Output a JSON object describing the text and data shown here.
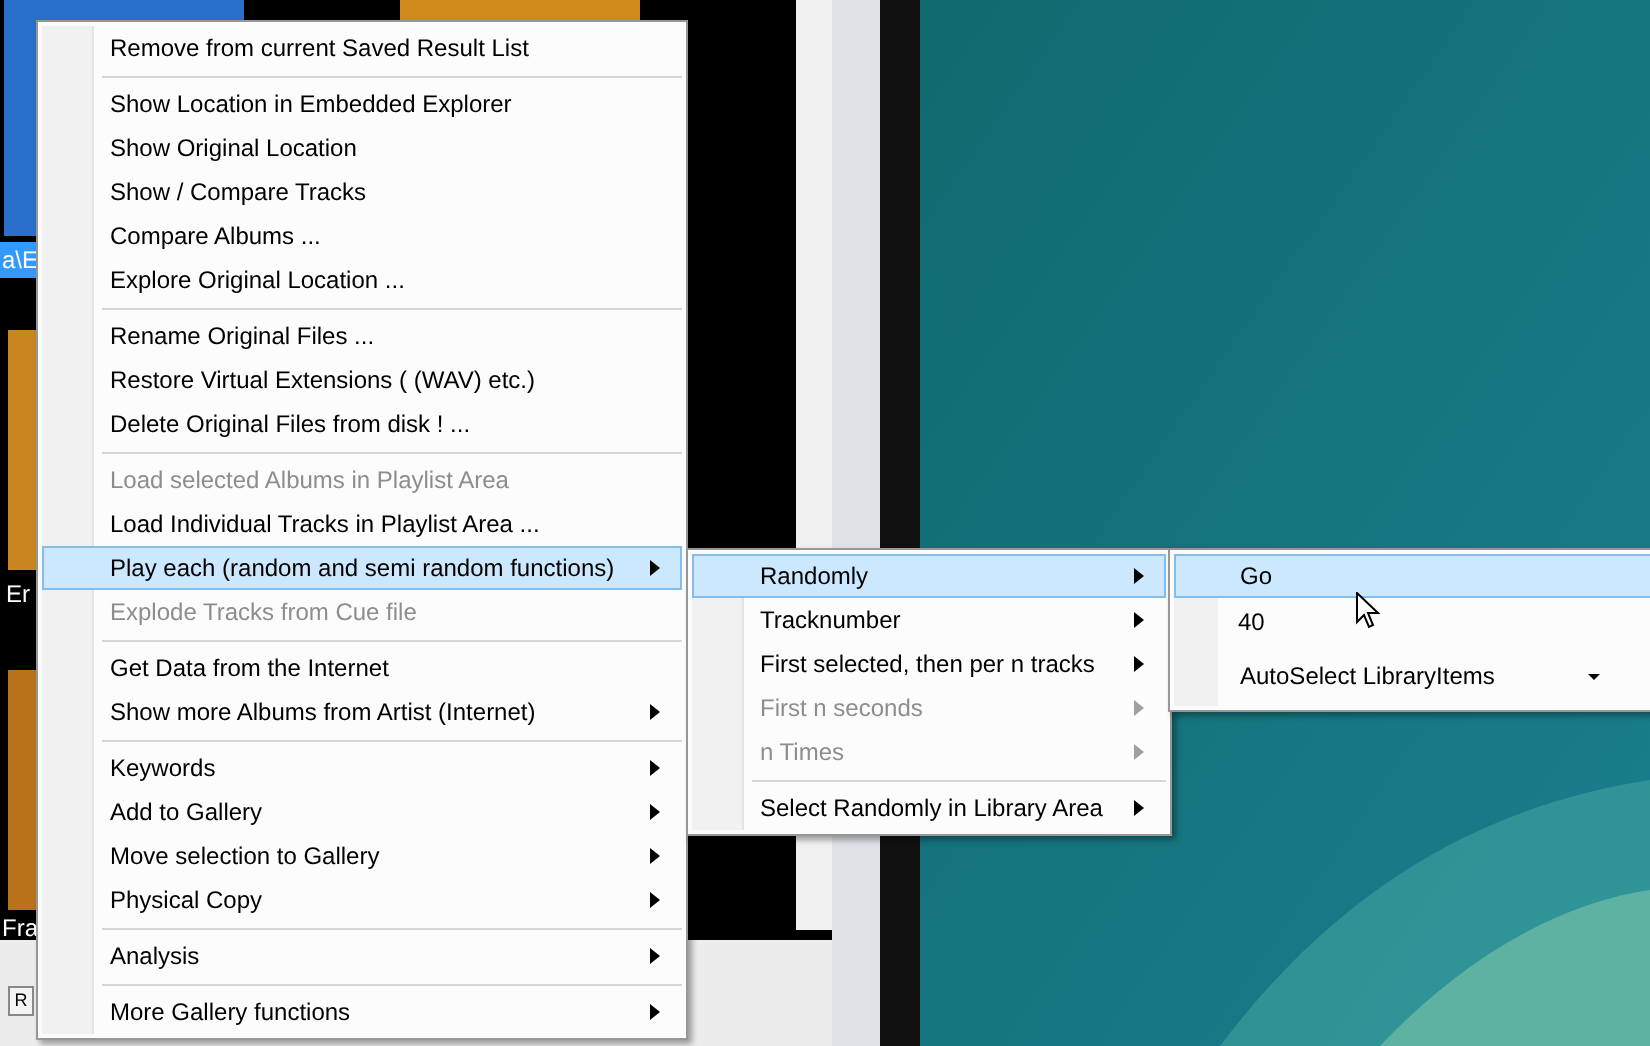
{
  "background_labels": [
    {
      "text": "a\\E",
      "selected": true
    },
    {
      "text": "Er",
      "selected": false
    },
    {
      "text": "Fra",
      "selected": false
    }
  ],
  "bottom_button": "R",
  "context_menu": {
    "items": [
      {
        "kind": "item",
        "label": "Remove from current Saved Result List",
        "disabled": false,
        "selected": false,
        "submenu": false
      },
      {
        "kind": "separator"
      },
      {
        "kind": "item",
        "label": "Show Location in Embedded Explorer",
        "disabled": false,
        "selected": false,
        "submenu": false
      },
      {
        "kind": "item",
        "label": "Show Original Location",
        "disabled": false,
        "selected": false,
        "submenu": false
      },
      {
        "kind": "item",
        "label": "Show / Compare Tracks",
        "disabled": false,
        "selected": false,
        "submenu": false
      },
      {
        "kind": "item",
        "label": "Compare Albums ...",
        "disabled": false,
        "selected": false,
        "submenu": false
      },
      {
        "kind": "item",
        "label": "Explore Original Location ...",
        "disabled": false,
        "selected": false,
        "submenu": false
      },
      {
        "kind": "separator"
      },
      {
        "kind": "item",
        "label": "Rename Original Files ...",
        "disabled": false,
        "selected": false,
        "submenu": false
      },
      {
        "kind": "item",
        "label": "Restore Virtual Extensions ( (WAV) etc.)",
        "disabled": false,
        "selected": false,
        "submenu": false
      },
      {
        "kind": "item",
        "label": "Delete Original Files from disk ! ...",
        "disabled": false,
        "selected": false,
        "submenu": false
      },
      {
        "kind": "separator"
      },
      {
        "kind": "item",
        "label": "Load selected Albums in Playlist Area",
        "disabled": true,
        "selected": false,
        "submenu": false
      },
      {
        "kind": "item",
        "label": "Load Individual Tracks in Playlist Area ...",
        "disabled": false,
        "selected": false,
        "submenu": false
      },
      {
        "kind": "item",
        "label": "Play each (random and semi random functions)",
        "disabled": false,
        "selected": true,
        "submenu": true
      },
      {
        "kind": "item",
        "label": "Explode Tracks from Cue file",
        "disabled": true,
        "selected": false,
        "submenu": false
      },
      {
        "kind": "separator"
      },
      {
        "kind": "item",
        "label": "Get Data from the Internet",
        "disabled": false,
        "selected": false,
        "submenu": false
      },
      {
        "kind": "item",
        "label": "Show more Albums from Artist (Internet)",
        "disabled": false,
        "selected": false,
        "submenu": true
      },
      {
        "kind": "separator"
      },
      {
        "kind": "item",
        "label": "Keywords",
        "disabled": false,
        "selected": false,
        "submenu": true
      },
      {
        "kind": "item",
        "label": "Add to Gallery",
        "disabled": false,
        "selected": false,
        "submenu": true
      },
      {
        "kind": "item",
        "label": "Move selection to Gallery",
        "disabled": false,
        "selected": false,
        "submenu": true
      },
      {
        "kind": "item",
        "label": "Physical Copy",
        "disabled": false,
        "selected": false,
        "submenu": true
      },
      {
        "kind": "separator"
      },
      {
        "kind": "item",
        "label": "Analysis",
        "disabled": false,
        "selected": false,
        "submenu": true
      },
      {
        "kind": "separator"
      },
      {
        "kind": "item",
        "label": "More Gallery functions",
        "disabled": false,
        "selected": false,
        "submenu": true
      }
    ]
  },
  "submenu": {
    "items": [
      {
        "kind": "item",
        "label": "Randomly",
        "disabled": false,
        "selected": true,
        "submenu": true
      },
      {
        "kind": "item",
        "label": "Tracknumber",
        "disabled": false,
        "selected": false,
        "submenu": true
      },
      {
        "kind": "item",
        "label": "First selected, then per n tracks",
        "disabled": false,
        "selected": false,
        "submenu": true
      },
      {
        "kind": "item",
        "label": "First n seconds",
        "disabled": true,
        "selected": false,
        "submenu": true
      },
      {
        "kind": "item",
        "label": "n Times",
        "disabled": true,
        "selected": false,
        "submenu": true
      },
      {
        "kind": "separator"
      },
      {
        "kind": "item",
        "label": "Select Randomly in Library Area",
        "disabled": false,
        "selected": false,
        "submenu": true
      }
    ]
  },
  "randomly_submenu": {
    "items": [
      {
        "kind": "button",
        "label": "Go",
        "selected": true
      },
      {
        "kind": "field",
        "value": "40"
      },
      {
        "kind": "dropdown",
        "value": "AutoSelect LibraryItems"
      }
    ]
  }
}
